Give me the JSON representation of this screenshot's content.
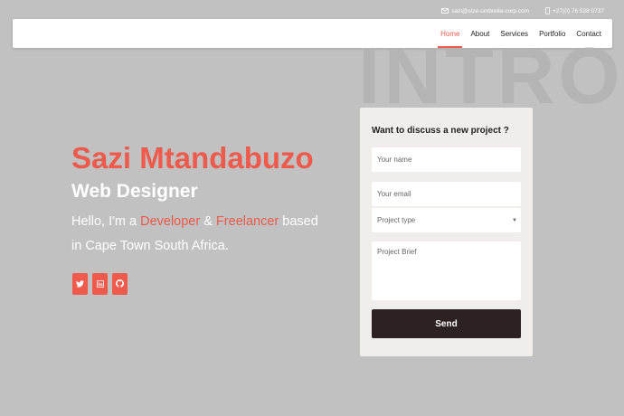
{
  "topbar": {
    "email": "sazi@size-umbrella-corp.com",
    "phone": "+27(0) 76 528 0737"
  },
  "nav": {
    "items": [
      {
        "label": "Home",
        "active": true
      },
      {
        "label": "About",
        "active": false
      },
      {
        "label": "Services",
        "active": false
      },
      {
        "label": "Portfolio",
        "active": false
      },
      {
        "label": "Contact",
        "active": false
      }
    ]
  },
  "hero": {
    "watermark": "INTRO",
    "name": "Sazi Mtandabuzo",
    "role": "Web Designer",
    "intro_prefix": "Hello, I'm a ",
    "intro_highlight_1": "Developer",
    "intro_and": " & ",
    "intro_highlight_2": "Freelancer",
    "intro_suffix": " based in Cape Town South Africa.",
    "socials": [
      "twitter-icon",
      "linkedin-icon",
      "github-icon"
    ]
  },
  "contact_form": {
    "title": "Want to discuss a new project ?",
    "name_placeholder": "Your name",
    "email_placeholder": "Your email",
    "project_type_value": "Project type",
    "brief_placeholder": "Project Brief",
    "send_label": "Send"
  },
  "colors": {
    "accent": "#ef5a4c",
    "background": "#c1c1c1",
    "card": "#f0eeeb",
    "button_dark": "#2c2221"
  }
}
